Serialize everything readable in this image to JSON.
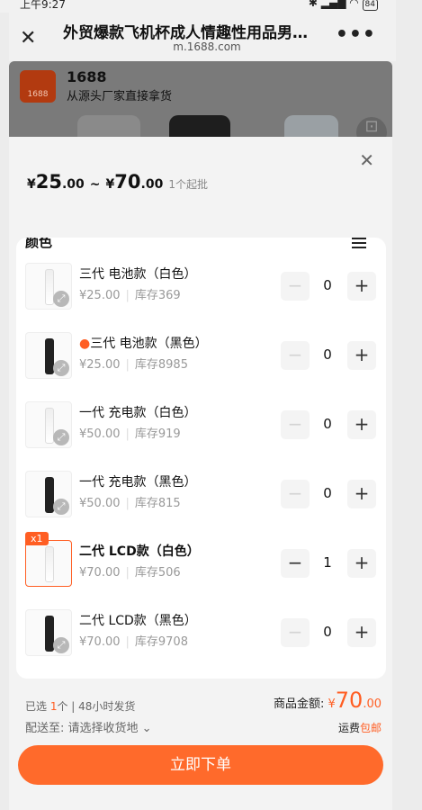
{
  "status_bar": {
    "time": "上午9:27",
    "battery": "84"
  },
  "browser": {
    "title": "外贸爆款飞机杯成人情趣性用品男…",
    "url": "m.1688.com",
    "close_icon": "close-icon",
    "more_label": "•••"
  },
  "background_page": {
    "brand": "1688",
    "slogan": "从源头厂家直接拿货",
    "logo_small": "1688"
  },
  "sheet": {
    "price_low_int": "25",
    "price_low_dec": ".00",
    "price_high_int": "70",
    "price_high_dec": ".00",
    "currency": "¥",
    "range_sep": "~",
    "moq": "1个起批",
    "section_title": "颜色",
    "items": [
      {
        "name": "三代 电池款（白色）",
        "price": "¥25.00",
        "stock": "库存369",
        "qty": "0",
        "color": "white"
      },
      {
        "name": "三代 电池款（黑色）",
        "price": "¥25.00",
        "stock": "库存8985",
        "qty": "0",
        "color": "black",
        "hot": true
      },
      {
        "name": "一代 充电款（白色）",
        "price": "¥50.00",
        "stock": "库存919",
        "qty": "0",
        "color": "white"
      },
      {
        "name": "一代 充电款（黑色）",
        "price": "¥50.00",
        "stock": "库存815",
        "qty": "0",
        "color": "black"
      },
      {
        "name": "二代 LCD款（白色）",
        "price": "¥70.00",
        "stock": "库存506",
        "qty": "1",
        "color": "white",
        "badge": "x1"
      },
      {
        "name": "二代 LCD款（黑色）",
        "price": "¥70.00",
        "stock": "库存9708",
        "qty": "0",
        "color": "black"
      }
    ]
  },
  "footer": {
    "selected_prefix": "已选",
    "selected_count": "1",
    "selected_suffix": "个 | 48小时发货",
    "ship_to": "配送至: 请选择收货地",
    "total_label": "商品金额:",
    "total_yen": "¥",
    "total_int": "70",
    "total_dec": ".00",
    "freight_label": "运费",
    "freight_value": "包邮",
    "order_button": "立即下单"
  },
  "colors": {
    "accent": "#ff5e23",
    "button": "#ff6a2b"
  }
}
